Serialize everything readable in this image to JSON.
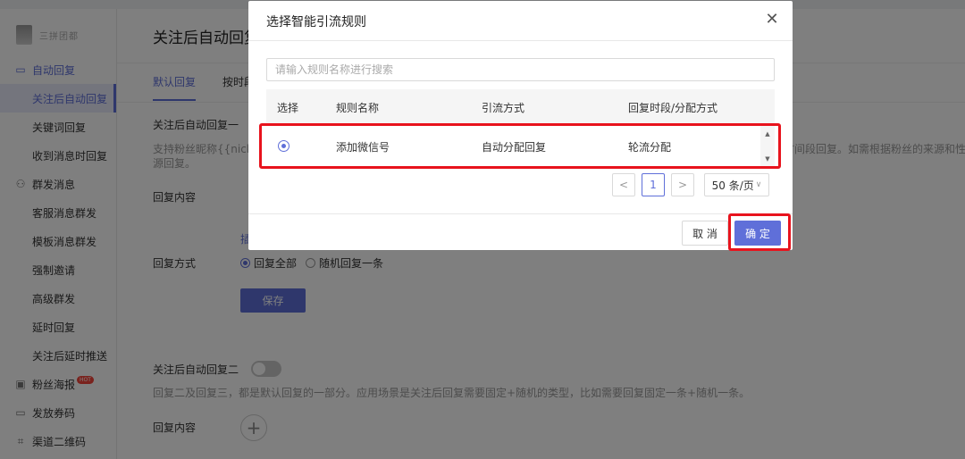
{
  "account": {
    "name": "三拼团都"
  },
  "sidebar": {
    "items": [
      {
        "type": "group",
        "label": "自动回复",
        "icon": "message-icon",
        "active": true
      },
      {
        "type": "sub",
        "label": "关注后自动回复",
        "active": true
      },
      {
        "type": "sub",
        "label": "关键词回复"
      },
      {
        "type": "sub",
        "label": "收到消息时回复"
      },
      {
        "type": "group",
        "label": "群发消息",
        "icon": "users-icon"
      },
      {
        "type": "sub",
        "label": "客服消息群发"
      },
      {
        "type": "sub",
        "label": "模板消息群发"
      },
      {
        "type": "sub",
        "label": "强制邀请"
      },
      {
        "type": "sub",
        "label": "高级群发"
      },
      {
        "type": "sub",
        "label": "延时回复"
      },
      {
        "type": "sub",
        "label": "关注后延时推送"
      },
      {
        "type": "group",
        "label": "粉丝海报",
        "icon": "poster-icon",
        "badge": "HOT"
      },
      {
        "type": "group",
        "label": "发放券码",
        "icon": "coupon-icon"
      },
      {
        "type": "group",
        "label": "渠道二维码",
        "icon": "qrcode-icon"
      }
    ]
  },
  "main": {
    "title": "关注后自动回复",
    "tabs": [
      "默认回复",
      "按时段"
    ],
    "section1": {
      "title": "关注后自动回复一",
      "desc_line1": "支持粉丝昵称{{nick_",
      "desc_line2": "源回复。",
      "desc_right": "时间段回复。如需根据粉丝的来源和性别",
      "content_label": "回复内容",
      "insert_link": "插",
      "mode_label": "回复方式",
      "mode_all": "回复全部",
      "mode_random": "随机回复一条",
      "save_label": "保存"
    },
    "section2": {
      "title": "关注后自动回复二",
      "desc": "回复二及回复三，都是默认回复的一部分。应用场景是关注后回复需要固定+随机的类型，比如需要回复固定一条+随机一条。",
      "content_label": "回复内容"
    }
  },
  "modal": {
    "title": "选择智能引流规则",
    "search_placeholder": "请输入规则名称进行搜索",
    "columns": [
      "选择",
      "规则名称",
      "引流方式",
      "回复时段/分配方式"
    ],
    "rows": [
      {
        "selected": true,
        "name": "添加微信号",
        "method": "自动分配回复",
        "schedule": "轮流分配"
      }
    ],
    "pagination": {
      "prev": "<",
      "current": "1",
      "next": ">",
      "page_size": "50 条/页"
    },
    "cancel_label": "取 消",
    "ok_label": "确 定"
  },
  "colors": {
    "accent": "#5f6fd9",
    "highlight": "#e8131d"
  }
}
